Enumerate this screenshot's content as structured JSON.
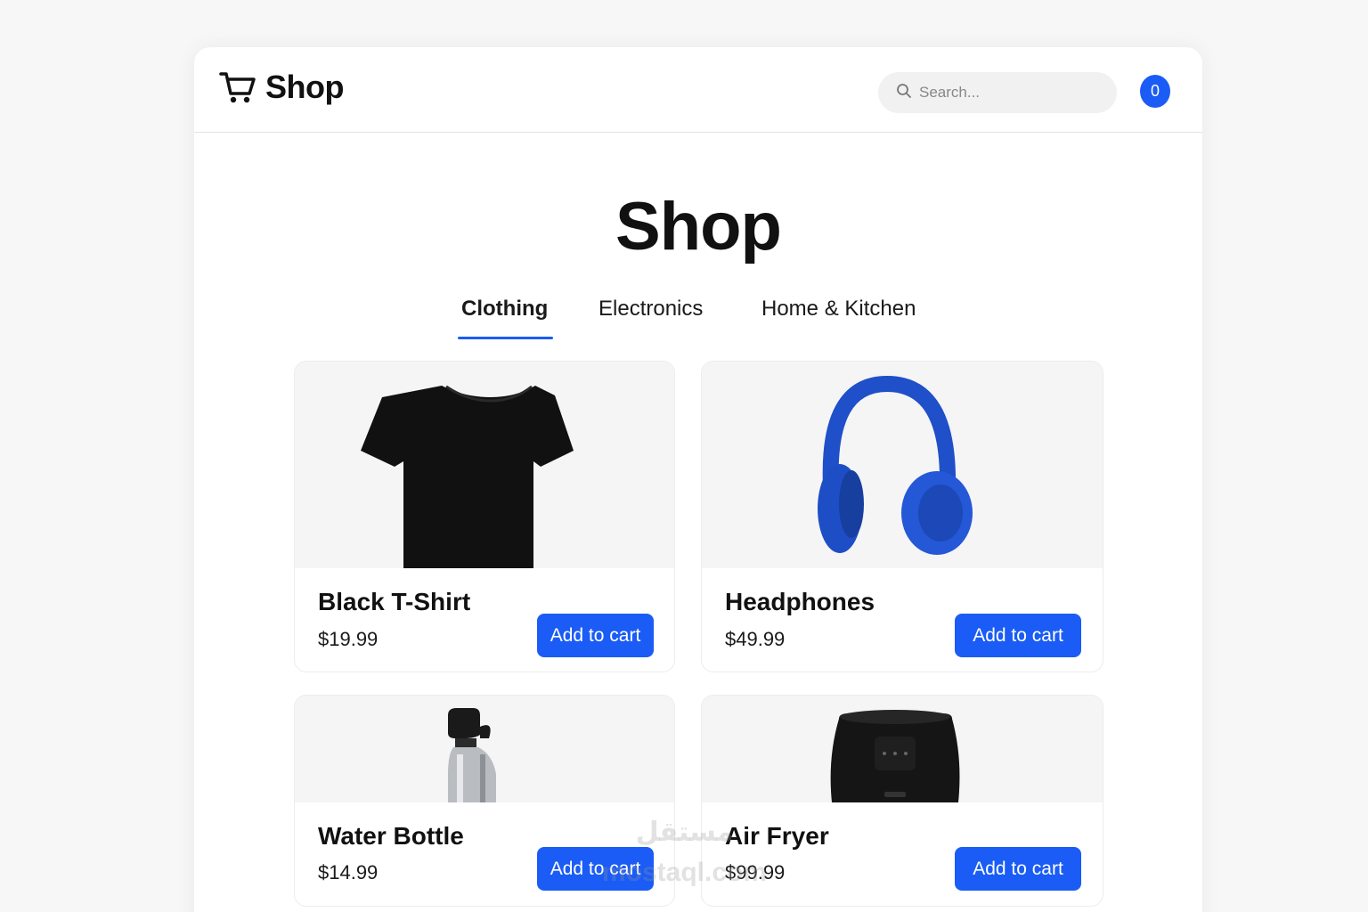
{
  "header": {
    "brand": "Shop",
    "search_placeholder": "Search...",
    "cart_count": "0"
  },
  "main": {
    "title": "Shop",
    "tabs": [
      {
        "label": "Clothing",
        "active": true
      },
      {
        "label": "Electronics",
        "active": false
      },
      {
        "label": "Home & Kitchen",
        "active": false
      }
    ]
  },
  "products": [
    {
      "name": "Black T-Shirt",
      "price": "$19.99",
      "button": "Add to cart",
      "image": "black-tshirt"
    },
    {
      "name": "Headphones",
      "price": "$49.99",
      "button": "Add to cart",
      "image": "blue-headphones"
    },
    {
      "name": "Water Bottle",
      "price": "$14.99",
      "button": "Add to cart",
      "image": "steel-water-bottle"
    },
    {
      "name": "Air Fryer",
      "price": "$99.99",
      "button": "Add to cart",
      "image": "black-air-fryer"
    }
  ],
  "watermark": {
    "arabic": "مستقل",
    "latin": "mostaql.com"
  },
  "colors": {
    "accent": "#1a5cf5",
    "image_bg": "#f5f5f6"
  }
}
